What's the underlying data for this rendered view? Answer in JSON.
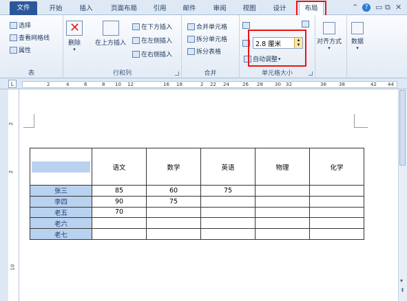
{
  "tabs": [
    "文件",
    "开始",
    "插入",
    "页面布局",
    "引用",
    "邮件",
    "审阅",
    "视图",
    "设计",
    "布局"
  ],
  "active_tab": "布局",
  "groups": {
    "table": {
      "label": "表",
      "items": [
        "选择",
        "查看网格线",
        "属性"
      ]
    },
    "rows_cols": {
      "label": "行和列",
      "delete": "删除",
      "insert_above": "在上方插入",
      "insert_below": "在下方插入",
      "insert_left": "在左侧插入",
      "insert_right": "在右侧插入"
    },
    "merge": {
      "label": "合并",
      "items": [
        "合并单元格",
        "拆分单元格",
        "拆分表格"
      ]
    },
    "cell_size": {
      "label": "单元格大小",
      "height_value": "2.8 厘米",
      "autofit": "自动调整"
    },
    "align": {
      "label": "对齐方式"
    },
    "data": {
      "label": "数据"
    }
  },
  "ruler_numbers": [
    "2",
    "4",
    "6",
    "8",
    "10",
    "12",
    "16",
    "18",
    "2",
    "22",
    "24",
    "26",
    "28",
    "30",
    "32",
    "36",
    "38",
    "42",
    "44"
  ],
  "vruler_numbers": [
    "2",
    "2",
    "10"
  ],
  "table": {
    "headers": [
      "",
      "语文",
      "数学",
      "英语",
      "物理",
      "化学"
    ],
    "rows": [
      [
        "张三",
        "85",
        "60",
        "75",
        "",
        ""
      ],
      [
        "李四",
        "90",
        "75",
        "",
        "",
        ""
      ],
      [
        "老五",
        "70",
        "",
        "",
        "",
        ""
      ],
      [
        "老六",
        "",
        "",
        "",
        "",
        ""
      ],
      [
        "老七",
        "",
        "",
        "",
        "",
        ""
      ]
    ]
  }
}
